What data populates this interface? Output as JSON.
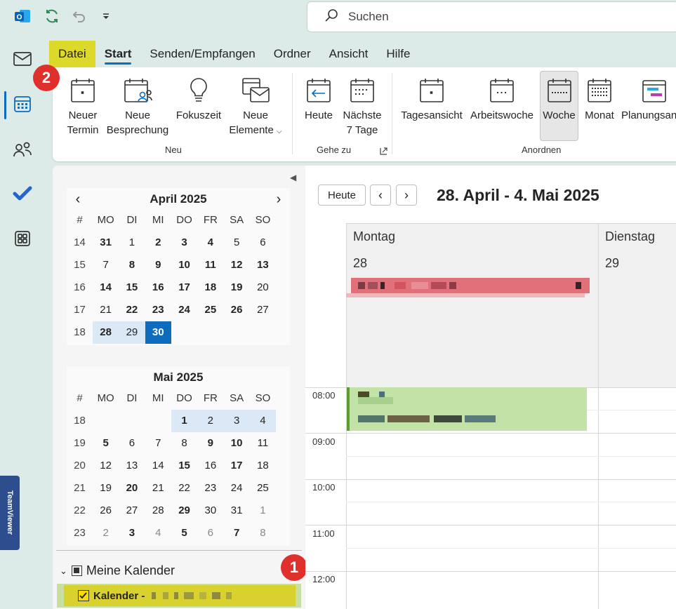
{
  "titlebar": {
    "search_placeholder": "Suchen"
  },
  "menu": {
    "tabs": [
      "Datei",
      "Start",
      "Senden/Empfangen",
      "Ordner",
      "Ansicht",
      "Hilfe"
    ]
  },
  "ribbon": {
    "new_appointment": [
      "Neuer",
      "Termin"
    ],
    "new_meeting": [
      "Neue",
      "Besprechung"
    ],
    "focus_time": "Fokuszeit",
    "new_items": [
      "Neue",
      "Elemente"
    ],
    "group_new": "Neu",
    "today": "Heute",
    "next7": [
      "Nächste",
      "7 Tage"
    ],
    "group_goto": "Gehe zu",
    "day_view": "Tagesansicht",
    "work_week": "Arbeitswoche",
    "week": "Woche",
    "month": "Monat",
    "schedule": "Planungsan",
    "group_arrange": "Anordnen"
  },
  "badges": {
    "badge1": "1",
    "badge2": "2"
  },
  "minical": {
    "weekday_header": [
      "#",
      "MO",
      "DI",
      "MI",
      "DO",
      "FR",
      "SA",
      "SO"
    ],
    "april": {
      "title": "April 2025",
      "rows": [
        [
          "14",
          "31",
          "1",
          "2",
          "3",
          "4",
          "5",
          "6"
        ],
        [
          "15",
          "7",
          "8",
          "9",
          "10",
          "11",
          "12",
          "13"
        ],
        [
          "16",
          "14",
          "15",
          "16",
          "17",
          "18",
          "19",
          "20"
        ],
        [
          "17",
          "21",
          "22",
          "23",
          "24",
          "25",
          "26",
          "27"
        ],
        [
          "18",
          "28",
          "29",
          "30",
          "",
          "",
          "",
          ""
        ]
      ]
    },
    "may": {
      "title": "Mai 2025",
      "rows": [
        [
          "18",
          "",
          "",
          "",
          "1",
          "2",
          "3",
          "4"
        ],
        [
          "19",
          "5",
          "6",
          "7",
          "8",
          "9",
          "10",
          "11"
        ],
        [
          "20",
          "12",
          "13",
          "14",
          "15",
          "16",
          "17",
          "18"
        ],
        [
          "21",
          "19",
          "20",
          "21",
          "22",
          "23",
          "24",
          "25"
        ],
        [
          "22",
          "26",
          "27",
          "28",
          "29",
          "30",
          "31",
          "1"
        ],
        [
          "23",
          "2",
          "3",
          "4",
          "5",
          "6",
          "7",
          "8"
        ]
      ]
    }
  },
  "folders": {
    "my_calendars": "Meine Kalender",
    "calendar_item": "Kalender -"
  },
  "view": {
    "today_button": "Heute",
    "date_range": "28. April - 4. Mai 2025",
    "days": [
      {
        "name": "Montag",
        "num": "28"
      },
      {
        "name": "Dienstag",
        "num": "29"
      }
    ],
    "times": [
      "08:00",
      "09:00",
      "10:00",
      "11:00",
      "12:00"
    ]
  },
  "teamviewer_label": "TeamViewer",
  "colors": {
    "accent": "#0f6cbd",
    "highlight": "#ddd92a",
    "badge": "#e0302c",
    "event_red": "#e2707a",
    "event_green": "#c3e2a8"
  }
}
